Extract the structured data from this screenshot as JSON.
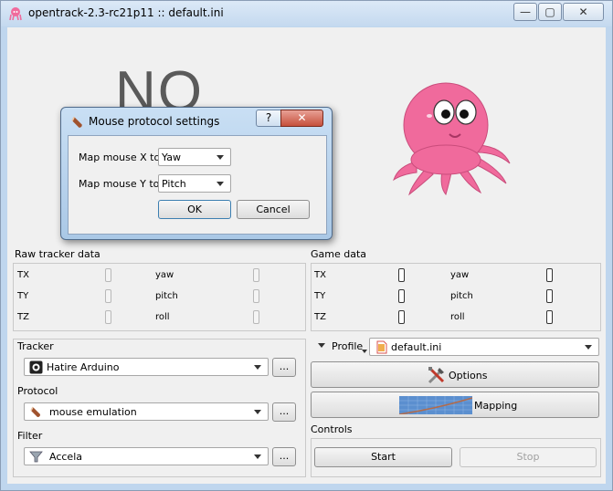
{
  "window": {
    "title": "opentrack-2.3-rc21p11 :: default.ini",
    "minimize_glyph": "—",
    "maximize_glyph": "▢",
    "close_glyph": "✕"
  },
  "status_text": "NO",
  "dialog": {
    "title": "Mouse protocol settings",
    "help_glyph": "?",
    "close_glyph": "✕",
    "map_x_label": "Map mouse X to:",
    "map_x_value": "Yaw",
    "map_y_label": "Map mouse Y to:",
    "map_y_value": "Pitch",
    "ok_label": "OK",
    "cancel_label": "Cancel"
  },
  "raw_tracker": {
    "label": "Raw tracker data",
    "rows": [
      {
        "left": "TX",
        "right": "yaw"
      },
      {
        "left": "TY",
        "right": "pitch"
      },
      {
        "left": "TZ",
        "right": "roll"
      }
    ]
  },
  "game_data": {
    "label": "Game data",
    "rows": [
      {
        "left": "TX",
        "right": "yaw"
      },
      {
        "left": "TY",
        "right": "pitch"
      },
      {
        "left": "TZ",
        "right": "roll"
      }
    ]
  },
  "tracker": {
    "label": "Tracker",
    "value": "Hatire Arduino",
    "more": "..."
  },
  "protocol": {
    "label": "Protocol",
    "value": "mouse emulation",
    "more": "..."
  },
  "filter": {
    "label": "Filter",
    "value": "Accela",
    "more": "..."
  },
  "profile": {
    "label": "Profile",
    "value": "default.ini"
  },
  "options_label": "Options",
  "mapping_label": "Mapping",
  "controls": {
    "label": "Controls",
    "start": "Start",
    "stop": "Stop"
  },
  "colors": {
    "octopus": "#f06a9c",
    "window_frame": "#bfd6ee"
  }
}
